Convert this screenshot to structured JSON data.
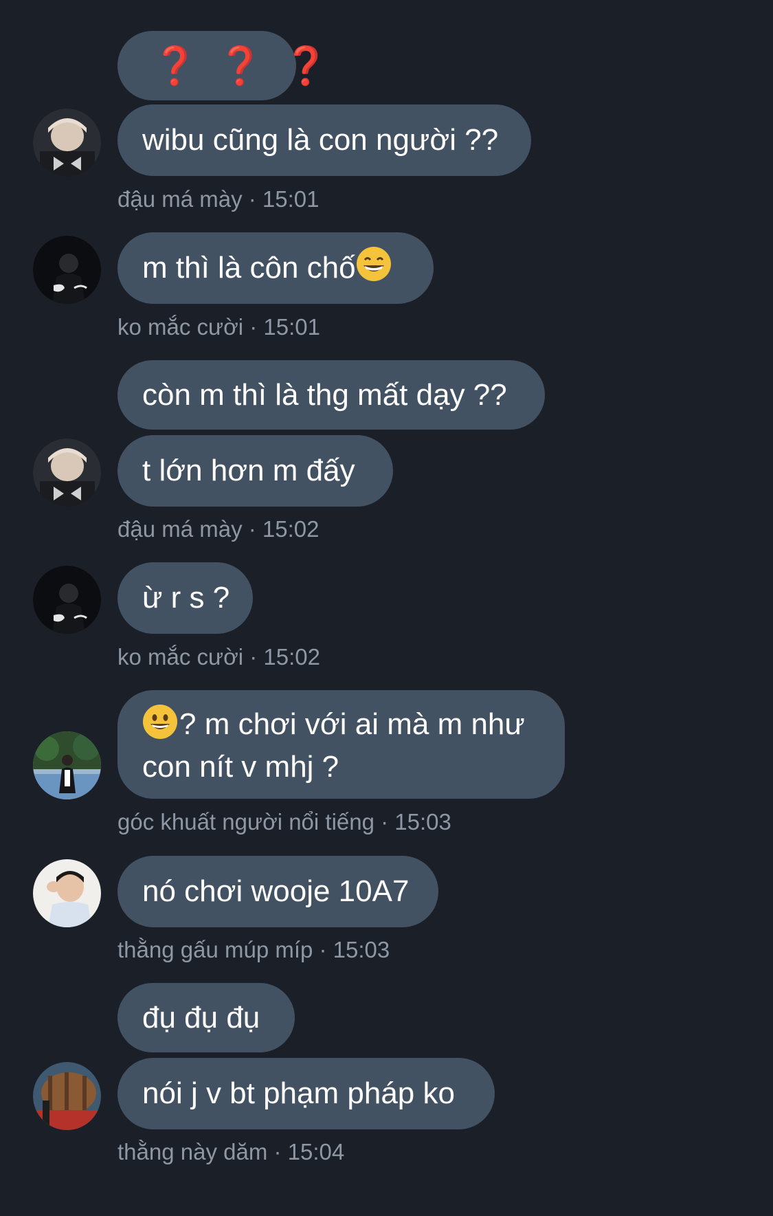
{
  "messages": [
    {
      "id": "m1",
      "text": "❓❓❓"
    },
    {
      "id": "m2",
      "text": "wibu cũng là con người ??"
    },
    {
      "id": "m3",
      "text": "m thì là côn chố"
    },
    {
      "id": "m4",
      "text": "còn m thì là thg mất dạy ??"
    },
    {
      "id": "m5",
      "text": "t lớn hơn m đấy"
    },
    {
      "id": "m6",
      "text": "ừ r s ?"
    },
    {
      "id": "m7",
      "text": "? m chơi với ai mà m như con nít v mhj ?"
    },
    {
      "id": "m8",
      "text": "nó chơi wooje 10A7"
    },
    {
      "id": "m9",
      "text": "đụ đụ đụ"
    },
    {
      "id": "m10",
      "text": "nói j v bt phạm pháp ko"
    }
  ],
  "meta": {
    "g1": "đậu má mày  · 15:01",
    "g2": "ko mắc cười · 15:01",
    "g3": "đậu má mày  · 15:02",
    "g4": "ko mắc cười · 15:02",
    "g5": "góc khuất người nổi tiếng · 15:03",
    "g6": "thằng gấu múp míp · 15:03",
    "g7": "thằng này dăm · 15:04"
  },
  "icons": {
    "grin": "grinning-face-with-smiling-eyes",
    "smile": "grinning-face"
  },
  "colors": {
    "background": "#1a1f28",
    "bubble": "#435263",
    "text": "#ffffff",
    "meta": "#8e97a2",
    "question": "#d63434"
  }
}
